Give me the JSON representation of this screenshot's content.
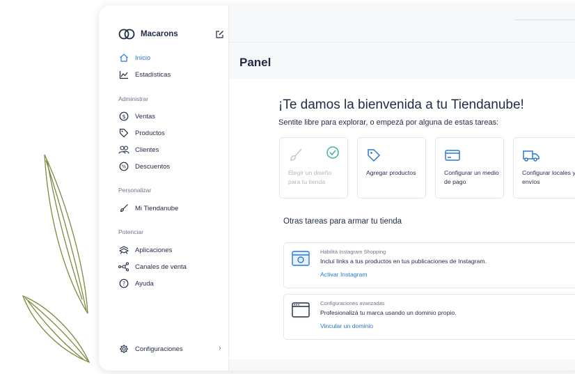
{
  "store": {
    "name": "Macarons"
  },
  "sidebar": {
    "top_items": [
      {
        "label": "Inicio",
        "icon": "home-icon",
        "active": true
      },
      {
        "label": "Estadísticas",
        "icon": "chart-icon",
        "active": false
      }
    ],
    "sections": [
      {
        "title": "Administrar",
        "items": [
          {
            "label": "Ventas",
            "icon": "dollar-icon"
          },
          {
            "label": "Productos",
            "icon": "tag-icon"
          },
          {
            "label": "Clientes",
            "icon": "users-icon"
          },
          {
            "label": "Descuentos",
            "icon": "percent-icon"
          }
        ]
      },
      {
        "title": "Personalizar",
        "items": [
          {
            "label": "Mi Tiendanube",
            "icon": "brush-icon"
          }
        ]
      },
      {
        "title": "Potenciar",
        "items": [
          {
            "label": "Aplicaciones",
            "icon": "apps-icon"
          },
          {
            "label": "Canales de venta",
            "icon": "network-icon"
          },
          {
            "label": "Ayuda",
            "icon": "help-icon"
          }
        ]
      }
    ],
    "settings": {
      "label": "Configuraciones",
      "icon": "gear-icon"
    }
  },
  "main": {
    "title": "Panel",
    "welcome": "¡Te damos la bienvenida a tu Tiendanube!",
    "subtitle": "Sentite libre para explorar, o empezá por alguna de estas tareas:",
    "cards": [
      {
        "label": "Elegir un diseño para tu tienda",
        "icon": "brush-icon",
        "done": true
      },
      {
        "label": "Agregar productos",
        "icon": "tag-icon",
        "done": false
      },
      {
        "label": "Configurar un medio de pago",
        "icon": "credit-card-icon",
        "done": false
      },
      {
        "label": "Configurar locales y envíos",
        "icon": "truck-icon",
        "done": false
      }
    ],
    "other_title": "Otras tareas para armar tu tienda",
    "tasks": [
      {
        "small": "Habilitá Instagram Shopping",
        "body": "Incluí links a tus productos en tus publicaciones de Instagram.",
        "link": "Activar Instagram",
        "icon": "instagram-icon"
      },
      {
        "small": "Configuraciones avanzadas",
        "body": "Profesionalizá tu marca usando un dominio propio.",
        "link": "Vincular un dominio",
        "icon": "browser-icon"
      }
    ]
  },
  "colors": {
    "accent": "#2979d6",
    "check": "#3cb49a",
    "text": "#1f2a44",
    "muted": "#6b7589"
  }
}
